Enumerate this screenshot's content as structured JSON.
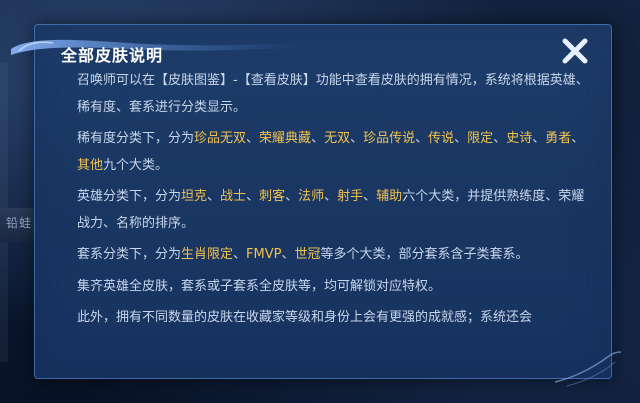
{
  "background": {
    "side_label": "铅蛙"
  },
  "dialog": {
    "title": "全部皮肤说明",
    "close_label": "关闭"
  },
  "colors": {
    "highlight": "#f2c24d",
    "body_text": "#c7d6ea",
    "panel": "#1c3a66",
    "border": "#3e6aa8"
  },
  "paragraphs": [
    {
      "segments": [
        {
          "text": "召唤师可以在【皮肤图鉴】-【查看皮肤】功能中查看皮肤的拥有情况，系统将根据英雄、稀有度、套系进行分类显示。",
          "highlight": false
        }
      ]
    },
    {
      "segments": [
        {
          "text": "稀有度分类下，分为",
          "highlight": false
        },
        {
          "text": "珍品无双",
          "highlight": true
        },
        {
          "text": "、",
          "highlight": false
        },
        {
          "text": "荣耀典藏",
          "highlight": true
        },
        {
          "text": "、",
          "highlight": false
        },
        {
          "text": "无双",
          "highlight": true
        },
        {
          "text": "、",
          "highlight": false
        },
        {
          "text": "珍品传说",
          "highlight": true
        },
        {
          "text": "、",
          "highlight": false
        },
        {
          "text": "传说",
          "highlight": true
        },
        {
          "text": "、",
          "highlight": false
        },
        {
          "text": "限定",
          "highlight": true
        },
        {
          "text": "、",
          "highlight": false
        },
        {
          "text": "史诗",
          "highlight": true
        },
        {
          "text": "、",
          "highlight": false
        },
        {
          "text": "勇者",
          "highlight": true
        },
        {
          "text": "、",
          "highlight": false
        },
        {
          "text": "其他",
          "highlight": true
        },
        {
          "text": "九个大类。",
          "highlight": false
        }
      ]
    },
    {
      "segments": [
        {
          "text": "英雄分类下，分为",
          "highlight": false
        },
        {
          "text": "坦克",
          "highlight": true
        },
        {
          "text": "、",
          "highlight": false
        },
        {
          "text": "战士",
          "highlight": true
        },
        {
          "text": "、",
          "highlight": false
        },
        {
          "text": "刺客",
          "highlight": true
        },
        {
          "text": "、",
          "highlight": false
        },
        {
          "text": "法师",
          "highlight": true
        },
        {
          "text": "、",
          "highlight": false
        },
        {
          "text": "射手",
          "highlight": true
        },
        {
          "text": "、",
          "highlight": false
        },
        {
          "text": "辅助",
          "highlight": true
        },
        {
          "text": "六个大类，并提供熟练度、荣耀战力、名称的排序。",
          "highlight": false
        }
      ]
    },
    {
      "segments": [
        {
          "text": "套系分类下，分为",
          "highlight": false
        },
        {
          "text": "生肖限定",
          "highlight": true
        },
        {
          "text": "、",
          "highlight": false
        },
        {
          "text": "FMVP",
          "highlight": true
        },
        {
          "text": "、",
          "highlight": false
        },
        {
          "text": "世冠",
          "highlight": true
        },
        {
          "text": "等多个大类，部分套系含子类套系。",
          "highlight": false
        }
      ]
    },
    {
      "segments": [
        {
          "text": "集齐英雄全皮肤，套系或子套系全皮肤等，均可解锁对应特权。",
          "highlight": false
        }
      ]
    },
    {
      "segments": [
        {
          "text": "此外，拥有不同数量的皮肤在收藏家等级和身份上会有更强的成就感；系统还会",
          "highlight": false
        }
      ]
    }
  ]
}
